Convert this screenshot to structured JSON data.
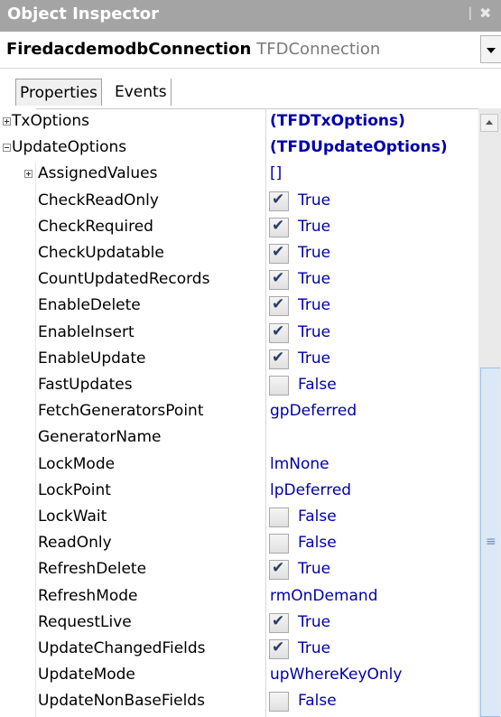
{
  "window": {
    "title": "Object Inspector",
    "pin_icon": "▕",
    "close_icon": "✖"
  },
  "selector": {
    "object_name": "FiredacdemodbConnection",
    "object_class": "TFDConnection"
  },
  "tabs": [
    {
      "label": "Properties",
      "active": true
    },
    {
      "label": "Events",
      "active": false
    }
  ],
  "properties": [
    {
      "name": "TxOptions",
      "value": "(TFDTxOptions)",
      "expander": "plus",
      "level": 0,
      "bold": true
    },
    {
      "name": "UpdateOptions",
      "value": "(TFDUpdateOptions)",
      "expander": "minus",
      "level": 0,
      "bold": true
    },
    {
      "name": "AssignedValues",
      "value": "[]",
      "expander": "plus",
      "level": 1
    },
    {
      "name": "CheckReadOnly",
      "value": "True",
      "checkbox": true,
      "checked": true,
      "level": 1
    },
    {
      "name": "CheckRequired",
      "value": "True",
      "checkbox": true,
      "checked": true,
      "level": 1
    },
    {
      "name": "CheckUpdatable",
      "value": "True",
      "checkbox": true,
      "checked": true,
      "level": 1
    },
    {
      "name": "CountUpdatedRecords",
      "value": "True",
      "checkbox": true,
      "checked": true,
      "level": 1
    },
    {
      "name": "EnableDelete",
      "value": "True",
      "checkbox": true,
      "checked": true,
      "level": 1
    },
    {
      "name": "EnableInsert",
      "value": "True",
      "checkbox": true,
      "checked": true,
      "level": 1
    },
    {
      "name": "EnableUpdate",
      "value": "True",
      "checkbox": true,
      "checked": true,
      "level": 1
    },
    {
      "name": "FastUpdates",
      "value": "False",
      "checkbox": true,
      "checked": false,
      "level": 1
    },
    {
      "name": "FetchGeneratorsPoint",
      "value": "gpDeferred",
      "level": 1
    },
    {
      "name": "GeneratorName",
      "value": "",
      "level": 1
    },
    {
      "name": "LockMode",
      "value": "lmNone",
      "level": 1
    },
    {
      "name": "LockPoint",
      "value": "lpDeferred",
      "level": 1
    },
    {
      "name": "LockWait",
      "value": "False",
      "checkbox": true,
      "checked": false,
      "level": 1
    },
    {
      "name": "ReadOnly",
      "value": "False",
      "checkbox": true,
      "checked": false,
      "level": 1
    },
    {
      "name": "RefreshDelete",
      "value": "True",
      "checkbox": true,
      "checked": true,
      "level": 1
    },
    {
      "name": "RefreshMode",
      "value": "rmOnDemand",
      "level": 1
    },
    {
      "name": "RequestLive",
      "value": "True",
      "checkbox": true,
      "checked": true,
      "level": 1
    },
    {
      "name": "UpdateChangedFields",
      "value": "True",
      "checkbox": true,
      "checked": true,
      "level": 1
    },
    {
      "name": "UpdateMode",
      "value": "upWhereKeyOnly",
      "level": 1
    },
    {
      "name": "UpdateNonBaseFields",
      "value": "False",
      "checkbox": true,
      "checked": false,
      "level": 1
    }
  ],
  "scrollbar": {
    "grip_icon": "≡"
  }
}
